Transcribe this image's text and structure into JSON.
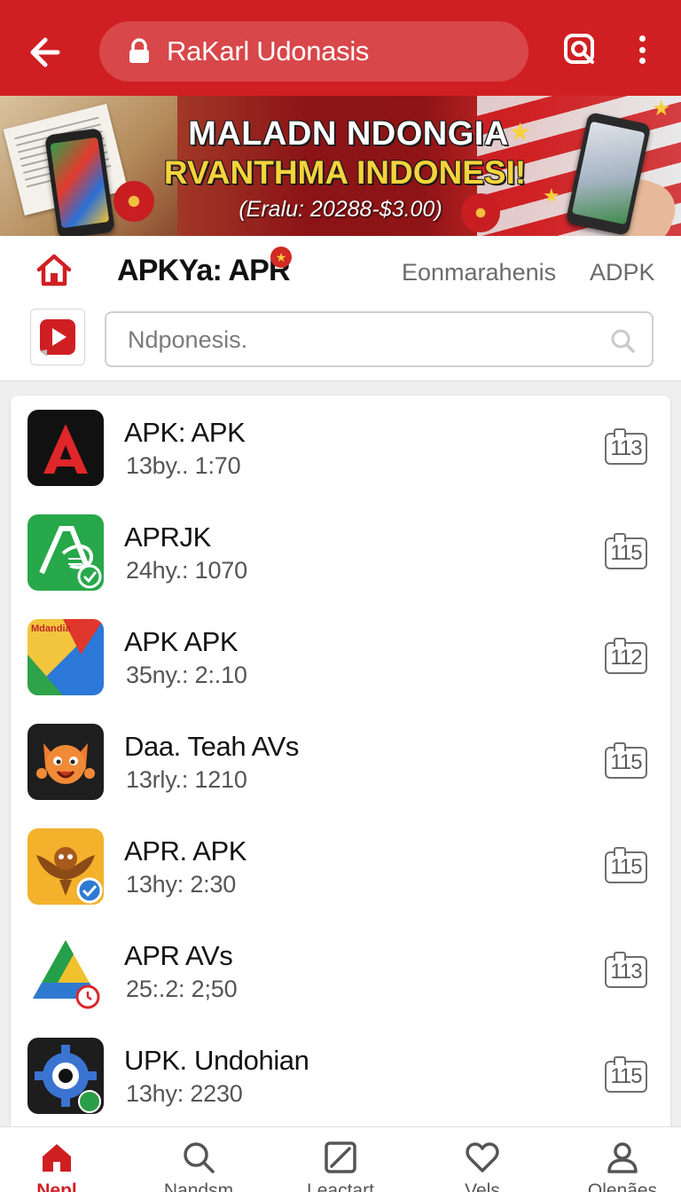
{
  "topbar": {
    "url": "RaKarl Udonasis",
    "colors": {
      "bar": "#d01f23",
      "text": "#ffffff"
    },
    "icons": [
      "back-arrow-icon",
      "lock-icon",
      "scan-search-icon",
      "more-vert-icon"
    ]
  },
  "banner": {
    "line1": "MALADN NDONGIA",
    "line2": "RVANTHMA INDONESI!",
    "line3": "(Eralu: 20288-$3.00)"
  },
  "header": {
    "brand": "APKYa: APR",
    "nav_1": "Eonmarahenis",
    "nav_2": "ADPK"
  },
  "search": {
    "placeholder": "Ndponesis."
  },
  "apps": [
    {
      "name": "APK: APK",
      "meta": "13by.. 1:70",
      "badge": "113"
    },
    {
      "name": "APRJK",
      "meta": "24hy.: 1070",
      "badge": "115"
    },
    {
      "name": "APK  APK",
      "meta": "35ny.: 2:.10",
      "badge": "112"
    },
    {
      "name": "Daa. Teah AVs",
      "meta": "13rly.: 1210",
      "badge": "115"
    },
    {
      "name": "APR. APK",
      "meta": "13hy: 2:30",
      "badge": "115"
    },
    {
      "name": "APR AVs",
      "meta": "25:.2: 2;50",
      "badge": "113"
    },
    {
      "name": "UPK. Undohian",
      "meta": "13hy: 2230",
      "badge": "115"
    }
  ],
  "app_icon_3_text": "Mdandia",
  "bottom_nav": [
    {
      "label": "Nepl",
      "icon": "home-icon",
      "active": true
    },
    {
      "label": "Nandsm",
      "icon": "search-icon",
      "active": false
    },
    {
      "label": "Leactart",
      "icon": "edit-square-icon",
      "active": false
    },
    {
      "label": "Vels",
      "icon": "heart-icon",
      "active": false
    },
    {
      "label": "Olenães",
      "icon": "profile-icon",
      "active": false
    }
  ],
  "accent_color": "#d01f23"
}
